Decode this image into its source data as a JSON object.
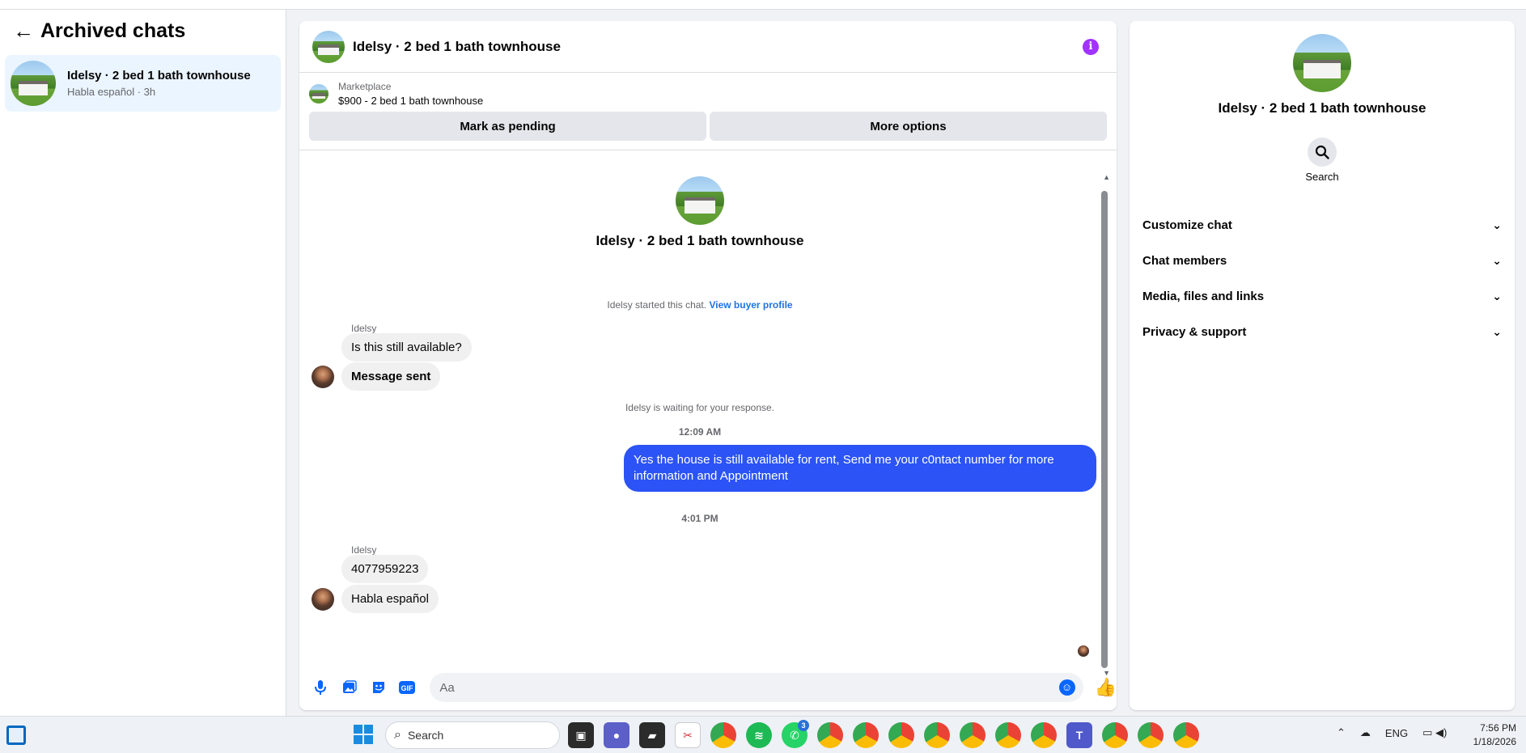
{
  "sidebar": {
    "title": "Archived chats",
    "chat": {
      "title": "Idelsy · 2 bed 1 bath townhouse",
      "subtitle": "Habla español · 3h"
    }
  },
  "chat": {
    "header_title": "Idelsy · 2 bed 1 bath townhouse",
    "marketplace_label": "Marketplace",
    "listing": "$900 - 2 bed 1 bath townhouse",
    "mark_pending": "Mark as pending",
    "more_options": "More options",
    "intro_title": "Idelsy · 2 bed 1 bath townhouse",
    "started_text": "Idelsy started this chat.",
    "view_profile": "View buyer profile",
    "sender_1": "Idelsy",
    "msg_1": "Is this still available?",
    "msg_2": "Message sent",
    "waiting": "Idelsy is waiting for your response.",
    "time_1": "12:09 AM",
    "msg_out": "Yes the house is still available for rent, Send me your c0ntact number for more information and Appointment",
    "time_2": "4:01 PM",
    "sender_2": "Idelsy",
    "msg_3": "4077959223",
    "msg_4": "Habla español",
    "composer_placeholder": "Aa"
  },
  "right_panel": {
    "title": "Idelsy · 2 bed 1 bath townhouse",
    "search_label": "Search",
    "sections": [
      "Customize chat",
      "Chat members",
      "Media, files and links",
      "Privacy & support"
    ]
  },
  "taskbar": {
    "search_label": "Search",
    "whatsapp_badge": "3",
    "lang": "ENG",
    "time": "7:56 PM",
    "date": "1/18/2026"
  },
  "colors": {
    "accent": "#0866ff",
    "outgoing_bubble": "#2b53f5",
    "info": "#a033ff"
  }
}
